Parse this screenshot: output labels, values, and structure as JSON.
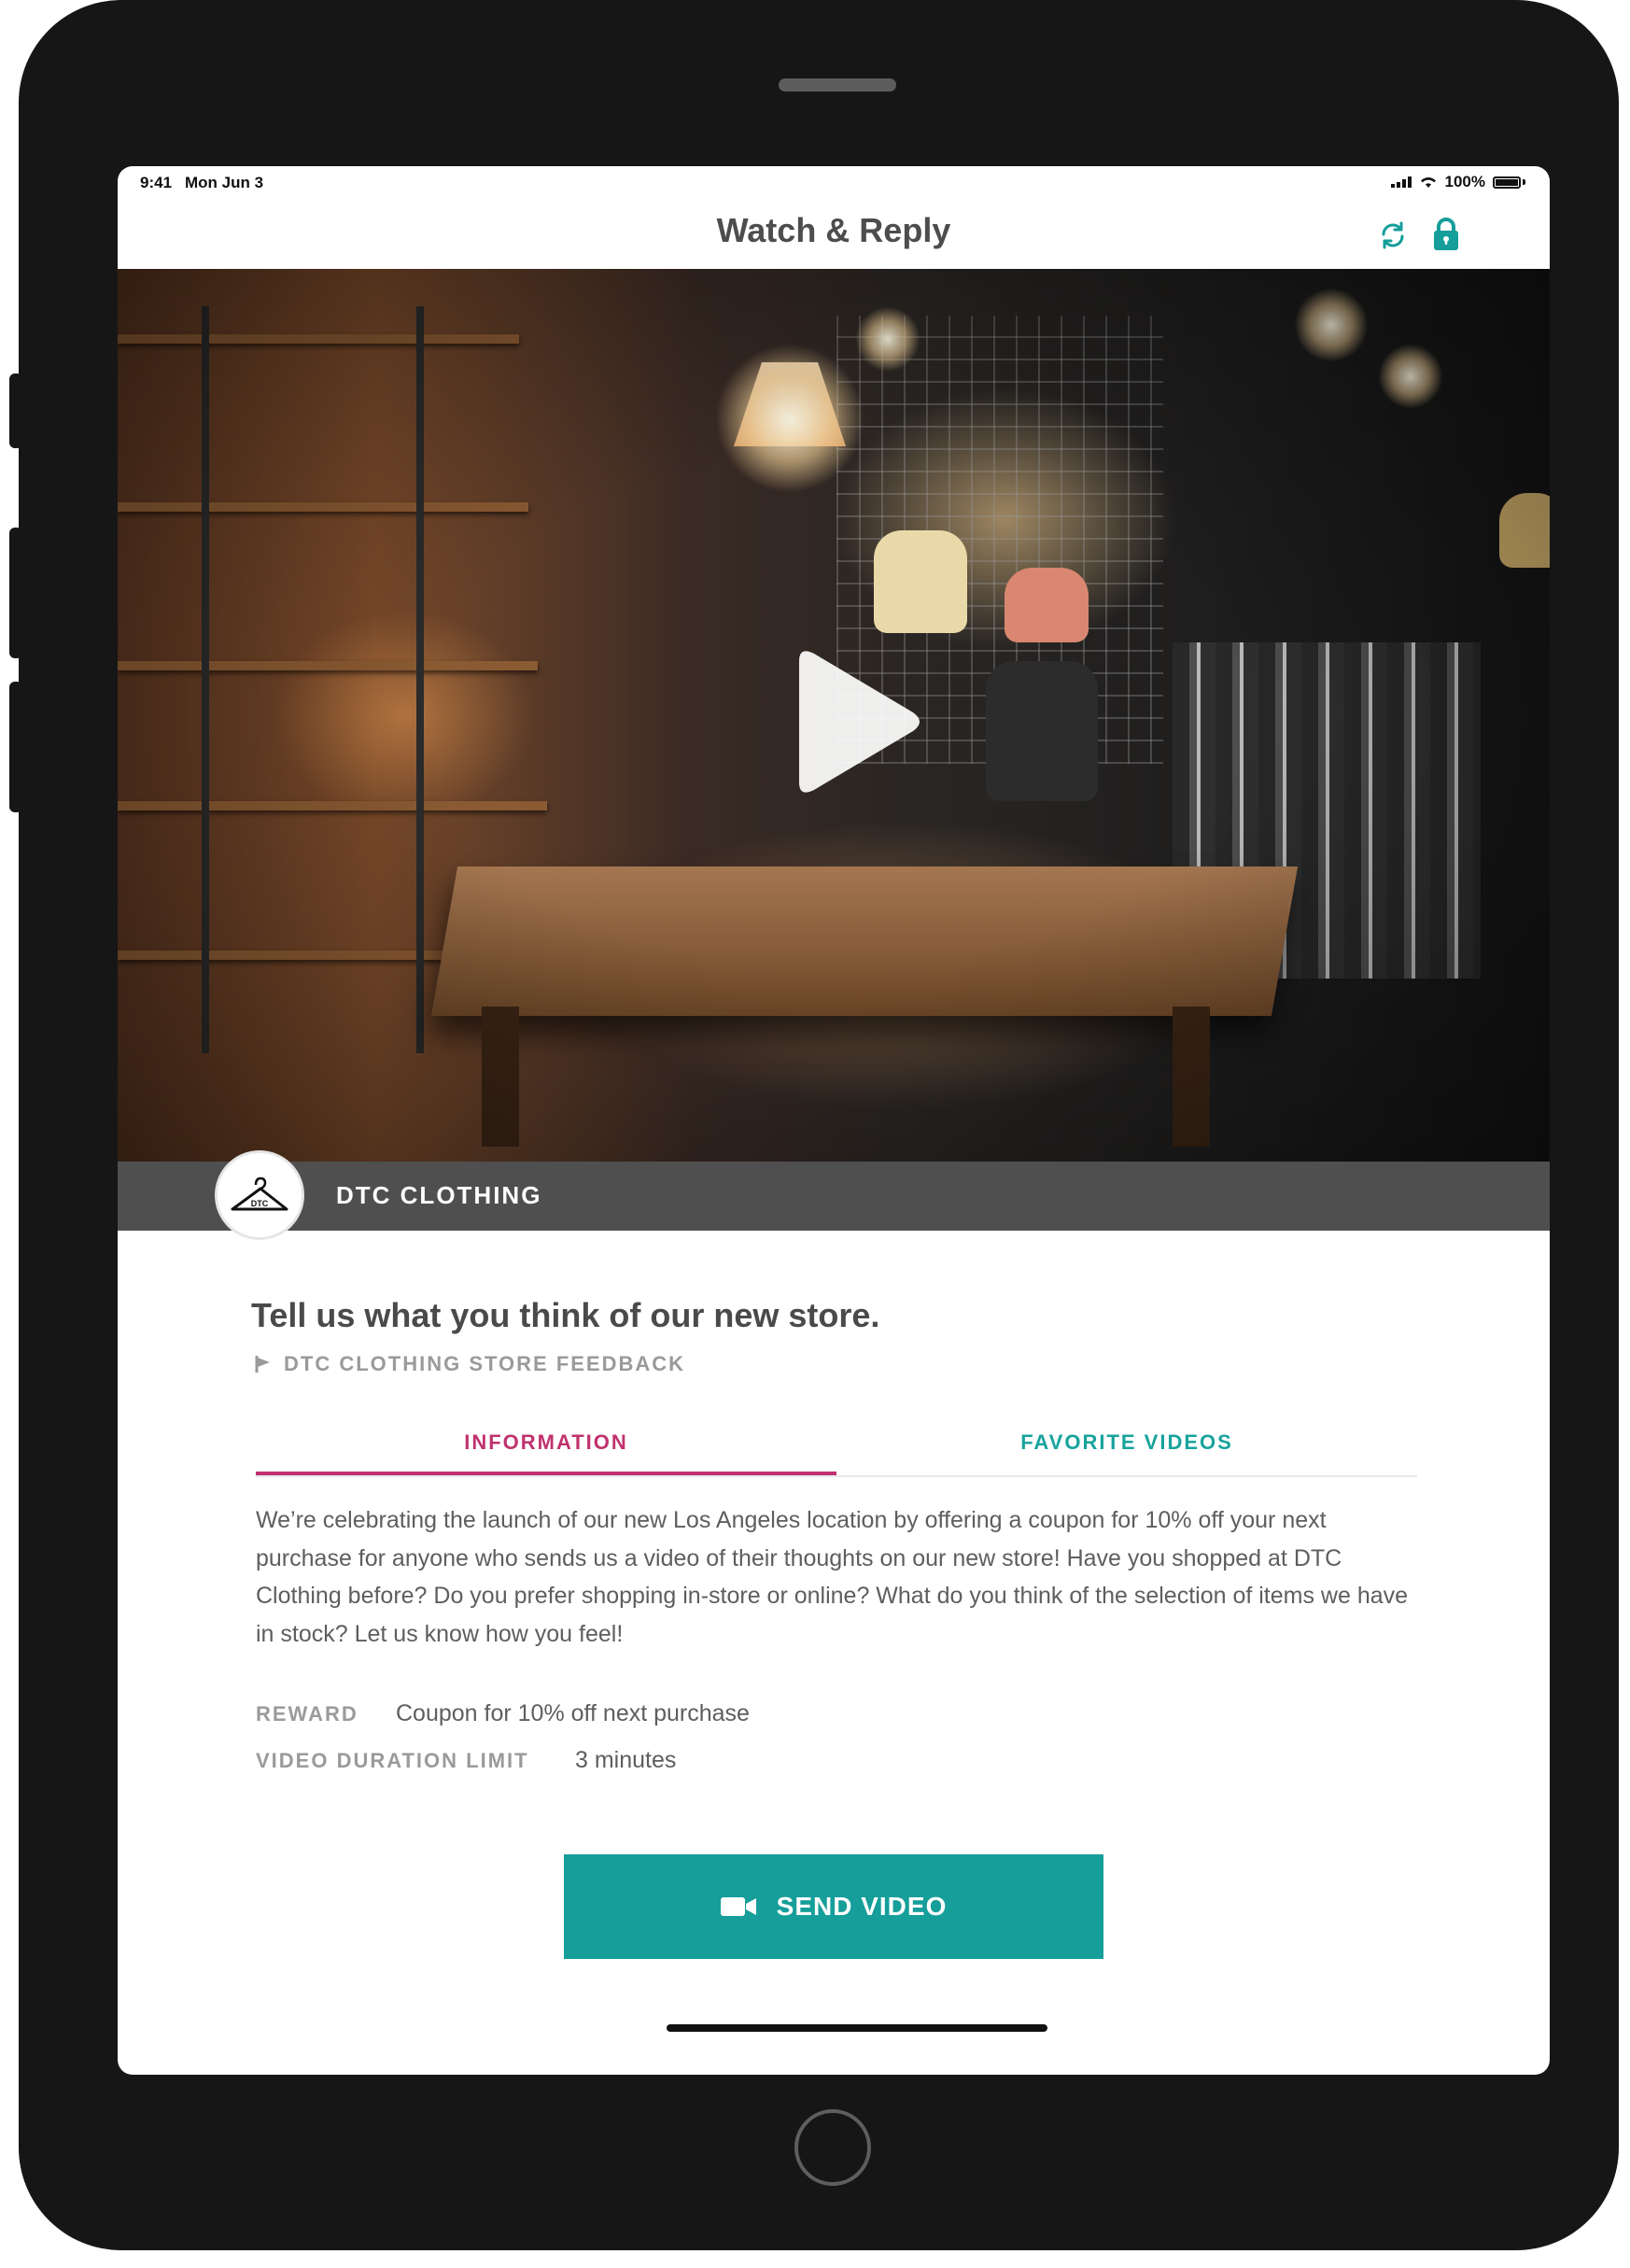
{
  "status_bar": {
    "time": "9:41",
    "date": "Mon Jun 3",
    "battery": "100%"
  },
  "nav": {
    "title": "Watch & Reply",
    "refresh_icon": "refresh-icon",
    "lock_icon": "lock-icon"
  },
  "video": {
    "play_icon": "play-icon",
    "brand_name": "DTC CLOTHING",
    "logo_text": "DTC"
  },
  "campaign": {
    "headline": "Tell us what you think of our new store.",
    "subtitle": "DTC CLOTHING STORE FEEDBACK"
  },
  "tabs": [
    {
      "label": "INFORMATION",
      "active": true
    },
    {
      "label": "FAVORITE VIDEOS",
      "active": false
    }
  ],
  "description": "We’re celebrating the launch of our new Los Angeles location by offering a coupon for 10% off your next purchase for anyone who sends us a video of their thoughts on our new store! Have you shopped at DTC Clothing before? Do you prefer shopping in-store or online? What do you think of the selection of items we have in stock? Let us know how you feel!",
  "details": {
    "reward_label": "REWARD",
    "reward_value": "Coupon for 10% off next purchase",
    "duration_label": "VIDEO DURATION LIMIT",
    "duration_value": "3 minutes"
  },
  "cta": {
    "label": "SEND VIDEO",
    "icon": "video-camera-icon"
  },
  "colors": {
    "accent_teal": "#159e9a",
    "accent_pink": "#c0326e",
    "brand_bar": "#4f4f4f"
  }
}
